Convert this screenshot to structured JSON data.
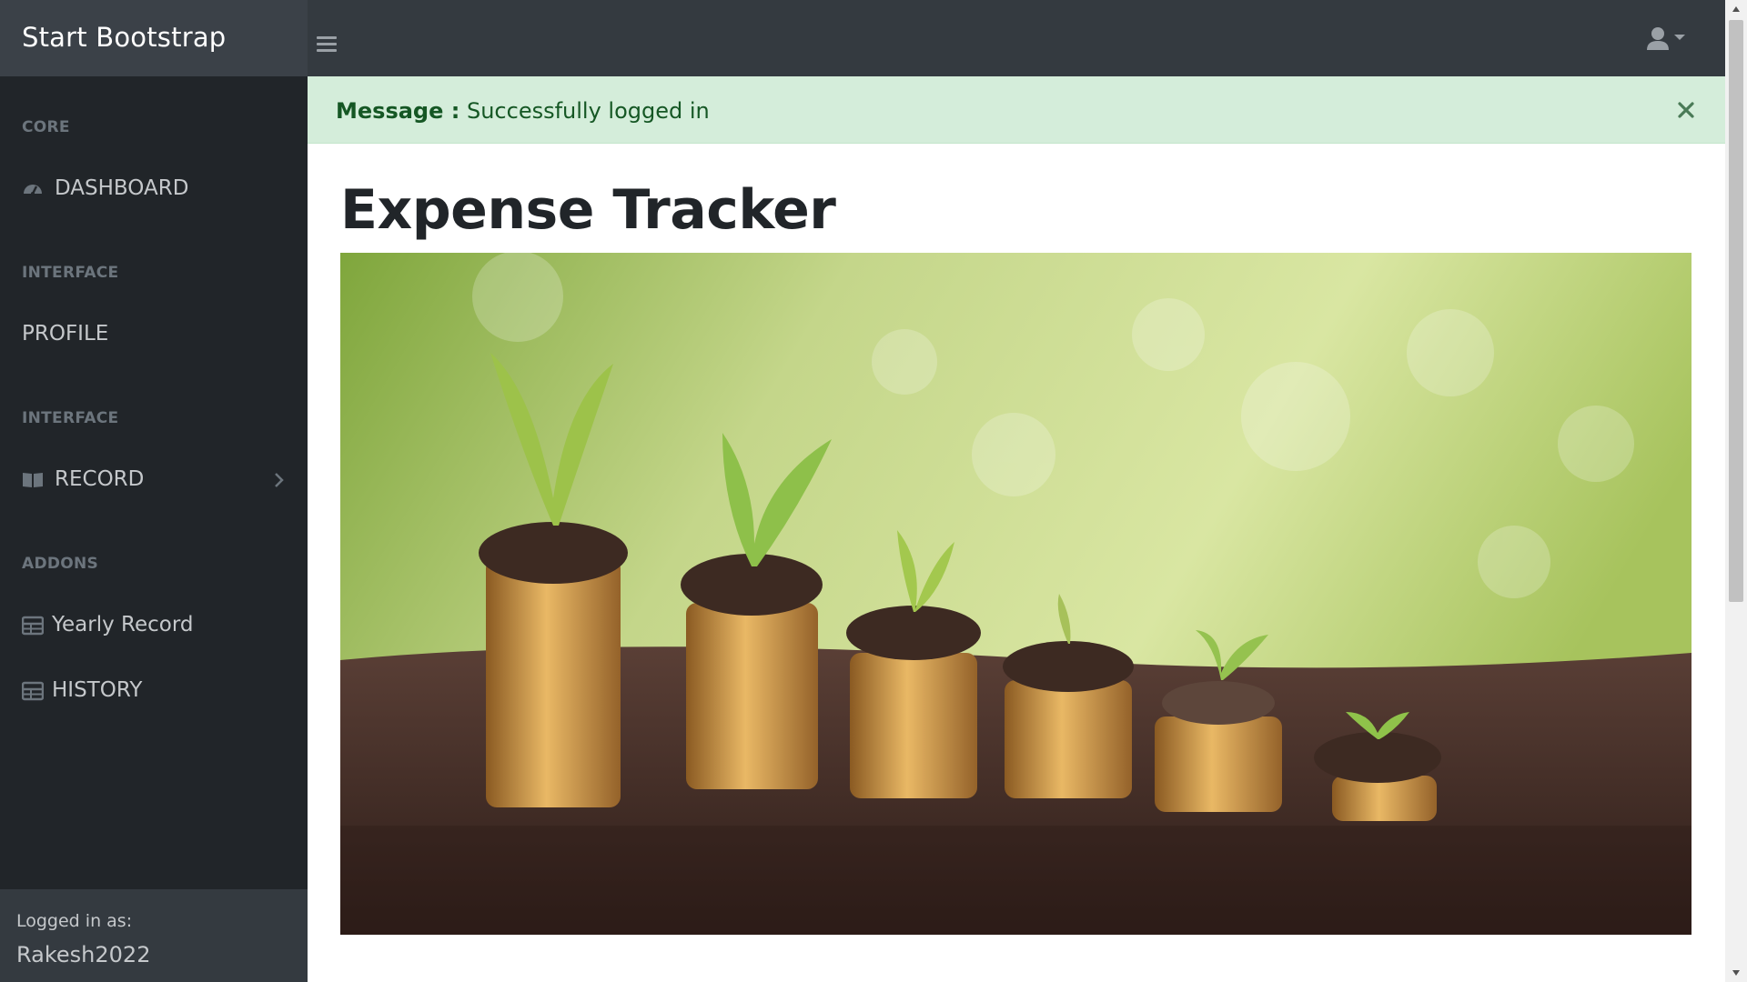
{
  "navbar": {
    "brand": "Start Bootstrap",
    "toggle_icon": "hamburger-icon",
    "user_icon": "user-icon"
  },
  "sidebar": {
    "sections": [
      {
        "heading": "CORE",
        "items": [
          {
            "label": "DASHBOARD",
            "icon": "tachometer-icon"
          }
        ]
      },
      {
        "heading": "INTERFACE",
        "items": [
          {
            "label": "PROFILE",
            "icon": ""
          }
        ]
      },
      {
        "heading": "INTERFACE",
        "items": [
          {
            "label": "RECORD",
            "icon": "book-icon",
            "has_children": true
          }
        ]
      },
      {
        "heading": "ADDONS",
        "items": [
          {
            "label": "Yearly Record",
            "icon": "table-icon"
          },
          {
            "label": "HISTORY",
            "icon": "table-icon"
          }
        ]
      }
    ],
    "footer": {
      "small": "Logged in as:",
      "user": "Rakesh2022"
    }
  },
  "alert": {
    "label": "Message :",
    "text": "Successfully logged in",
    "color_bg": "#d4edda",
    "color_text": "#155724"
  },
  "main": {
    "title": "Expense Tracker",
    "hero_image": "coins-plants-soil-image"
  },
  "colors": {
    "navbar": "#343a40",
    "sidebar": "#212529",
    "sidebar_heading": "#6c757d",
    "sidebar_link": "#c5c8cb"
  }
}
